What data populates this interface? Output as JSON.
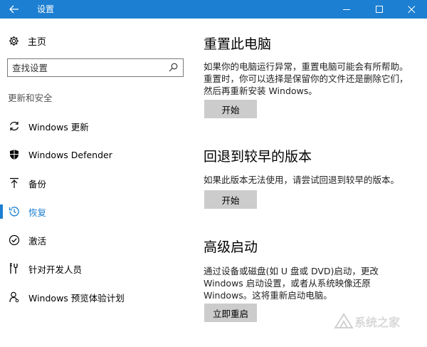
{
  "window": {
    "title": "设置",
    "accent": "#1c7fd1"
  },
  "sidebar": {
    "home_label": "主页",
    "search_placeholder": "查找设置",
    "section_label": "更新和安全",
    "items": [
      {
        "label": "Windows 更新",
        "icon": "sync-icon"
      },
      {
        "label": "Windows Defender",
        "icon": "shield-icon"
      },
      {
        "label": "备份",
        "icon": "upload-icon"
      },
      {
        "label": "恢复",
        "icon": "history-icon",
        "active": true
      },
      {
        "label": "激活",
        "icon": "check-circle-icon"
      },
      {
        "label": "针对开发人员",
        "icon": "tools-icon"
      },
      {
        "label": "Windows 预览体验计划",
        "icon": "person-icon"
      }
    ]
  },
  "content": {
    "reset": {
      "title": "重置此电脑",
      "desc_lines": [
        "如果你的电脑运行异常，重置电脑可能会有所帮助。",
        "重置时，你可以选择是保留你的文件还是删除它们，",
        "然后再重新安装 Windows。"
      ],
      "button": "开始"
    },
    "rollback": {
      "title": "回退到较早的版本",
      "desc_lines": [
        "如果此版本无法使用，请尝试回退到较早的版本。"
      ],
      "button": "开始"
    },
    "advanced": {
      "title": "高级启动",
      "desc_lines": [
        "通过设备或磁盘(如 U 盘或 DVD)启动，更改",
        "Windows 启动设置，或者从系统映像还原",
        "Windows。这将重新启动电脑。"
      ],
      "button": "立即重启"
    }
  },
  "watermark": {
    "text": "系统之家"
  }
}
